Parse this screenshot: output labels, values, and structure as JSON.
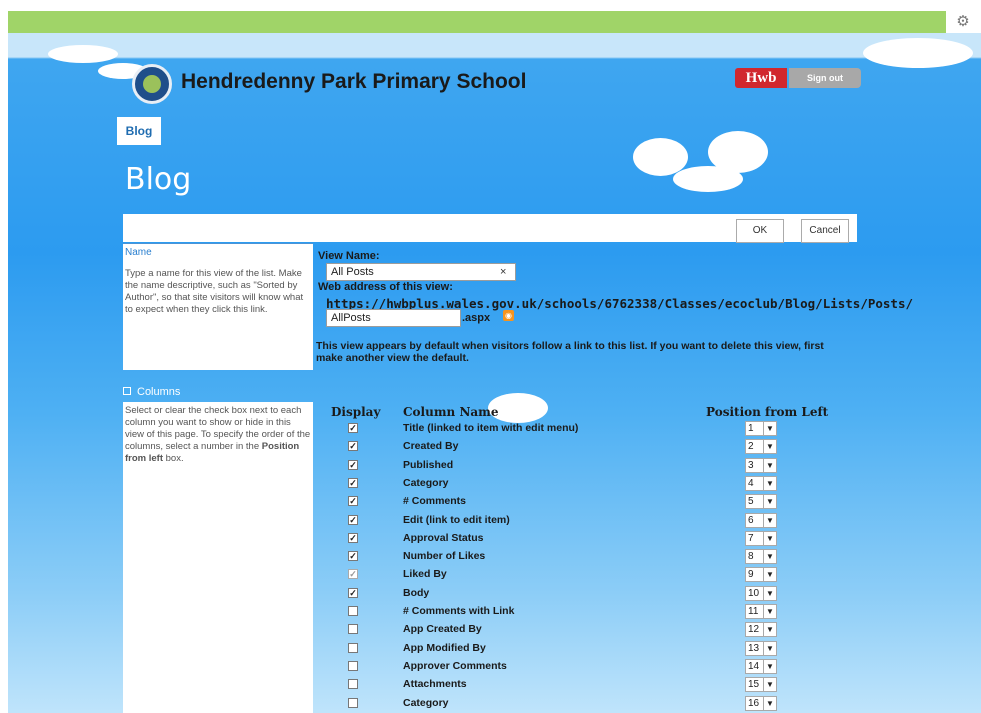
{
  "site": {
    "title": "Hendredenny Park Primary School",
    "hwb_label": "Hwb",
    "sign_out_label": "Sign out",
    "nav_tab": "Blog",
    "page_title": "Blog"
  },
  "toolbar": {
    "ok_label": "OK",
    "cancel_label": "Cancel"
  },
  "name_section": {
    "title": "Name",
    "description": "Type a name for this view of the list. Make the name descriptive, such as \"Sorted by Author\", so that site visitors will know what to expect when they click this link.",
    "view_name_label": "View Name:",
    "view_name_value": "All Posts",
    "clear_glyph": "×",
    "web_address_label": "Web address of this view:",
    "url_base": "https://hwbplus.wales.gov.uk/schools/6762338/Classes/ecoclub/Blog/Lists/Posts/",
    "url_value": "AllPosts",
    "url_suffix": ".aspx",
    "default_note": "This view appears by default when visitors follow a link to this list. If you want to delete this view, first make another view the default."
  },
  "columns_section": {
    "title": "Columns",
    "description_pre": "Select or clear the check box next to each column you want to show or hide in this view of this page. To specify the order of the columns, select a number in the ",
    "description_bold": "Position from left",
    "description_post": " box.",
    "headers": {
      "display": "Display",
      "column_name": "Column Name",
      "position": "Position from Left"
    },
    "rows": [
      {
        "name": "Title (linked to item with edit menu)",
        "checked": true,
        "position": "1"
      },
      {
        "name": "Created By",
        "checked": true,
        "position": "2"
      },
      {
        "name": "Published",
        "checked": true,
        "position": "3"
      },
      {
        "name": "Category",
        "checked": true,
        "position": "4"
      },
      {
        "name": "# Comments",
        "checked": true,
        "position": "5"
      },
      {
        "name": "Edit (link to edit item)",
        "checked": true,
        "position": "6"
      },
      {
        "name": "Approval Status",
        "checked": true,
        "position": "7"
      },
      {
        "name": "Number of Likes",
        "checked": true,
        "position": "8"
      },
      {
        "name": "Liked By",
        "checked": true,
        "disabled": true,
        "position": "9"
      },
      {
        "name": "Body",
        "checked": true,
        "position": "10"
      },
      {
        "name": "# Comments with Link",
        "checked": false,
        "position": "11"
      },
      {
        "name": "App Created By",
        "checked": false,
        "position": "12"
      },
      {
        "name": "App Modified By",
        "checked": false,
        "position": "13"
      },
      {
        "name": "Approver Comments",
        "checked": false,
        "position": "14"
      },
      {
        "name": "Attachments",
        "checked": false,
        "position": "15"
      },
      {
        "name": "Category",
        "checked": false,
        "position": "16"
      }
    ]
  },
  "icons": {
    "settings": "gear-icon",
    "rss": "rss-icon",
    "collapse": "collapse-icon",
    "dropdown": "chevron-down-icon"
  },
  "colors": {
    "top_bar": "#a0d468",
    "sky": "#2c9bf0",
    "hwb_red": "#d1272e"
  }
}
